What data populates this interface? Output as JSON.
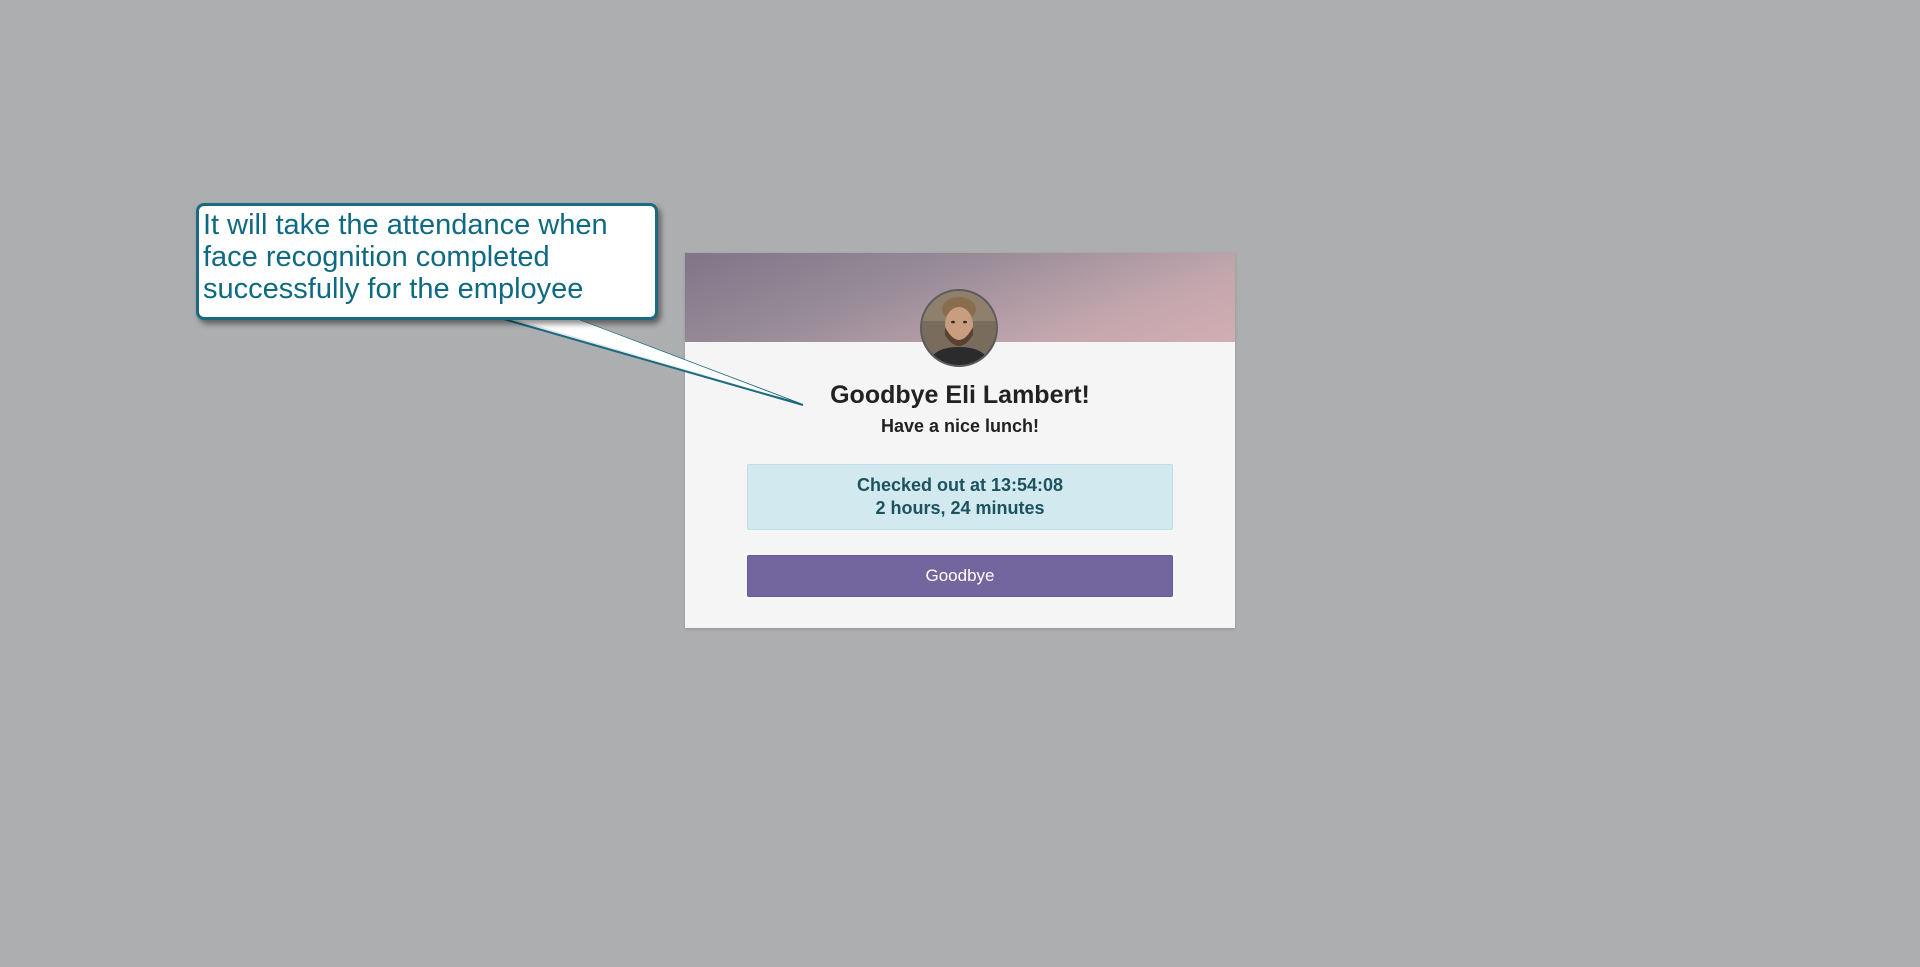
{
  "callout": {
    "text_line1": "It will take the attendance when",
    "text_line2": "face recognition completed",
    "text_line3": "successfully for the employee"
  },
  "card": {
    "greeting": "Goodbye Eli Lambert!",
    "subgreeting": "Have a nice lunch!",
    "checked_out": "Checked out at 13:54:08",
    "duration": "2 hours, 24 minutes",
    "button_label": "Goodbye"
  },
  "colors": {
    "background": "#adaeb0",
    "card_background": "#f5f5f5",
    "info_background": "#d1e9ef",
    "info_text": "#1c535f",
    "button_background": "#73659d",
    "callout_text": "#0e6a83",
    "callout_border": "#1b6a80"
  },
  "icons": {
    "avatar": "employee-photo"
  }
}
